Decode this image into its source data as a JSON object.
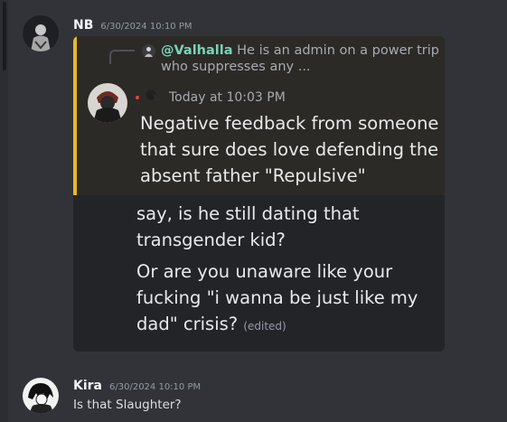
{
  "messages": [
    {
      "username": "NB",
      "timestamp": "6/30/2024 10:10 PM",
      "quote": {
        "reply_mention": "@Valhalla",
        "reply_text": " He is an admin on a power trip who suppresses any ...",
        "time": "Today at 10:03 PM",
        "text": "Negative feedback from someone that sure does love defending the absent father \"Repulsive\""
      },
      "lines": [
        "say, is he still dating that transgender kid?",
        "Or are you unaware like your fucking \"i wanna be just like my dad\" crisis?"
      ],
      "edited_label": "(edited)"
    },
    {
      "username": "Kira",
      "timestamp": "6/30/2024 10:10 PM",
      "text": "Is that Slaughter?"
    }
  ],
  "colors": {
    "background": "#313338",
    "embed_background": "#232428",
    "quote_accent": "#e8b825",
    "mention": "#7ad3b8"
  }
}
